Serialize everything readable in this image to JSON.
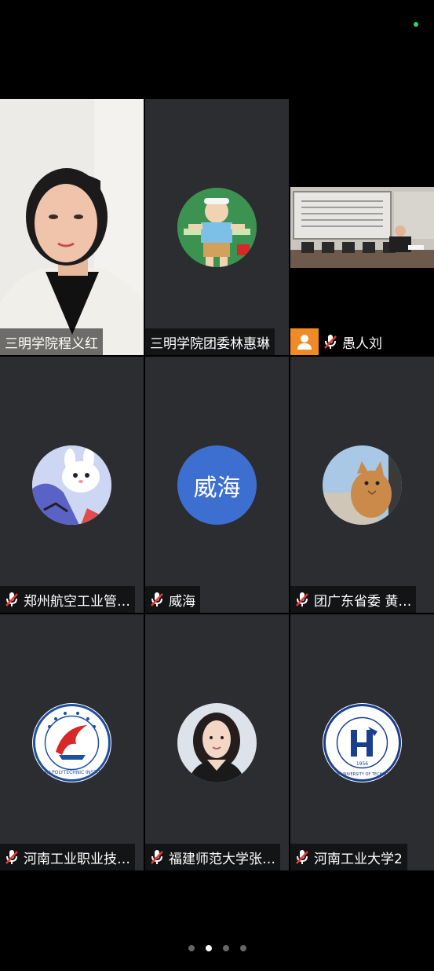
{
  "participants": [
    {
      "name": "三明学院程义红",
      "type": "video-person"
    },
    {
      "name": "三明学院团委林惠琳",
      "type": "avatar-photo",
      "icon": "baby-cartoon-avatar"
    },
    {
      "name": "愚人刘",
      "type": "video-room",
      "badge": "person-icon",
      "muted": true
    },
    {
      "name": "郑州航空工业管…",
      "type": "avatar-photo",
      "icon": "bunny-cartoon-avatar",
      "muted": true
    },
    {
      "name": "威海",
      "type": "avatar-text",
      "avatar_text": "威海",
      "muted": true
    },
    {
      "name": "团广东省委 黄…",
      "type": "avatar-photo",
      "icon": "cat-photo-avatar",
      "muted": true
    },
    {
      "name": "河南工业职业技…",
      "type": "avatar-logo",
      "icon": "henan-polytechnic-logo",
      "logo_caption": "HENAN POLYTECHNIC INSTITUTE",
      "muted": true
    },
    {
      "name": "福建师范大学张…",
      "type": "avatar-photo",
      "icon": "girl-portrait-avatar",
      "muted": true
    },
    {
      "name": "河南工业大学2",
      "type": "avatar-logo",
      "icon": "henan-university-of-technology-logo",
      "logo_caption": "HENAN UNIVERSITY OF TECHNOLOGY",
      "logo_year": "1956",
      "muted": true
    }
  ],
  "pager": {
    "count": 4,
    "active_index": 1
  },
  "colors": {
    "tile_bg": "#2c2d30",
    "avatar_blue": "#3d6fd1",
    "badge_orange": "#f08a24",
    "mic_muted_red": "#e53935",
    "status_green": "#2bd96b"
  }
}
